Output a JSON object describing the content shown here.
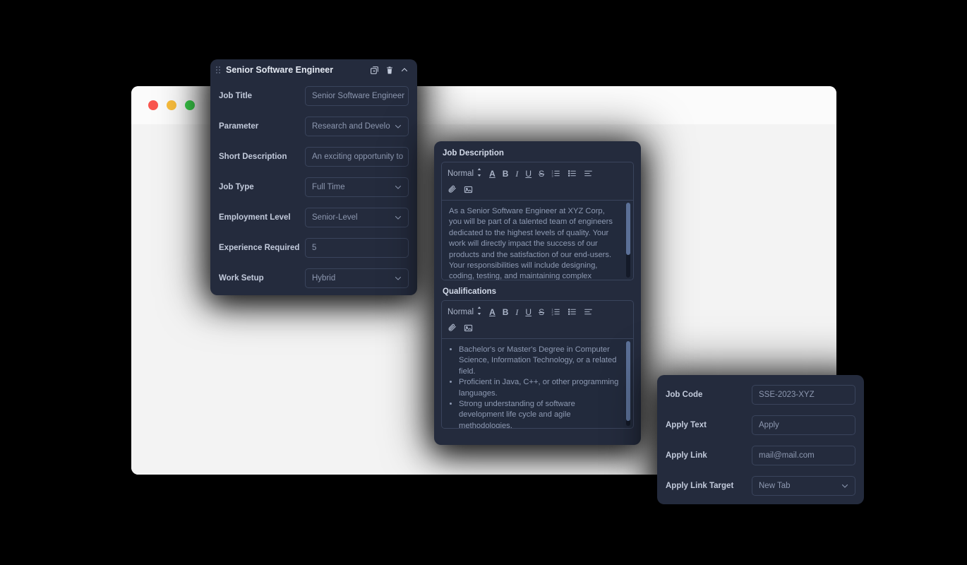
{
  "browser": {
    "traffic_lights": [
      "red",
      "yellow",
      "green"
    ],
    "reload_icon": "refresh-icon"
  },
  "job_panel": {
    "title": "Senior Software Engineer",
    "drag_handle_icon": "drag-handle-icon",
    "actions": [
      {
        "icon": "duplicate-icon",
        "label": "Duplicate"
      },
      {
        "icon": "trash-icon",
        "label": "Delete"
      },
      {
        "icon": "chevron-up-icon",
        "label": "Collapse"
      }
    ],
    "fields": [
      {
        "label": "Job Title",
        "value": "Senior Software Engineer",
        "type": "text"
      },
      {
        "label": "Parameter",
        "value": "Research and Develo",
        "type": "select"
      },
      {
        "label": "Short Description",
        "value": "An exciting opportunity to",
        "type": "text"
      },
      {
        "label": "Job Type",
        "value": "Full Time",
        "type": "select"
      },
      {
        "label": "Employment Level",
        "value": "Senior-Level",
        "type": "select"
      },
      {
        "label": "Experience Required",
        "value": "5",
        "type": "text"
      },
      {
        "label": "Work Setup",
        "value": "Hybrid",
        "type": "select"
      }
    ]
  },
  "editor_panel": {
    "description": {
      "label": "Job Description",
      "toolbar": {
        "format": "Normal",
        "stepper_icon": "stepper-updown-icon",
        "buttons": [
          {
            "icon": "text-color-icon",
            "glyph": "A"
          },
          {
            "icon": "bold-icon",
            "glyph": "B"
          },
          {
            "icon": "italic-icon",
            "glyph": "I"
          },
          {
            "icon": "underline-icon",
            "glyph": "U"
          },
          {
            "icon": "strikethrough-icon",
            "glyph": "S"
          },
          {
            "icon": "ordered-list-icon",
            "glyph": ""
          },
          {
            "icon": "bullet-list-icon",
            "glyph": ""
          },
          {
            "icon": "align-left-icon",
            "glyph": ""
          }
        ],
        "buttons_row2": [
          {
            "icon": "link-icon",
            "glyph": ""
          },
          {
            "icon": "image-icon",
            "glyph": ""
          }
        ]
      },
      "body": "As a Senior Software Engineer at XYZ Corp, you will be part of a talented team of engineers dedicated to the highest levels of quality. Your work will directly impact the success of our products and the satisfaction of our end-users. Your responsibilities will include designing, coding, testing, and maintaining complex software applications, working closely with other team",
      "scroll_thumb_percent": 70
    },
    "qualifications": {
      "label": "Qualifications",
      "toolbar": {
        "format": "Normal",
        "stepper_icon": "stepper-updown-icon",
        "buttons": [
          {
            "icon": "text-color-icon",
            "glyph": "A"
          },
          {
            "icon": "bold-icon",
            "glyph": "B"
          },
          {
            "icon": "italic-icon",
            "glyph": "I"
          },
          {
            "icon": "underline-icon",
            "glyph": "U"
          },
          {
            "icon": "strikethrough-icon",
            "glyph": "S"
          },
          {
            "icon": "ordered-list-icon",
            "glyph": ""
          },
          {
            "icon": "bullet-list-icon",
            "glyph": ""
          },
          {
            "icon": "align-left-icon",
            "glyph": ""
          }
        ],
        "buttons_row2": [
          {
            "icon": "link-icon",
            "glyph": ""
          },
          {
            "icon": "image-icon",
            "glyph": ""
          }
        ]
      },
      "items": [
        "Bachelor's or Master's Degree in Computer Science, Information Technology, or a related field.",
        "Proficient in Java, C++, or other programming languages.",
        "Strong understanding of software development life cycle and agile methodologies."
      ],
      "scroll_thumb_percent": 94
    }
  },
  "apply_panel": {
    "fields": [
      {
        "label": "Job Code",
        "value": "SSE-2023-XYZ",
        "type": "text"
      },
      {
        "label": "Apply Text",
        "value": "Apply",
        "type": "text"
      },
      {
        "label": "Apply Link",
        "value": "mail@mail.com",
        "type": "text"
      },
      {
        "label": "Apply Link Target",
        "value": "New Tab",
        "type": "select"
      }
    ]
  },
  "colors": {
    "panel_bg": "#242b3d",
    "page_bg": "#000000",
    "browser_bg": "#f3f3f3",
    "label_text": "#c3cbdc",
    "value_text": "#8d98b0",
    "border": "#3a445c",
    "scrollbar": "#5b7097"
  }
}
